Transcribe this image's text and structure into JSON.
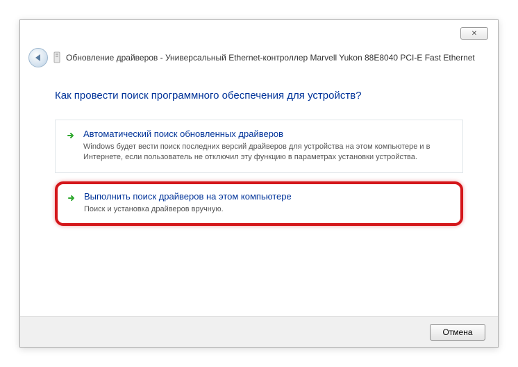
{
  "window": {
    "close_glyph": "✕",
    "title": "Обновление драйверов - Универсальный Ethernet-контроллер Marvell Yukon 88E8040 PCI-E Fast Ethernet"
  },
  "content": {
    "heading": "Как провести поиск программного обеспечения для устройств?",
    "options": [
      {
        "title": "Автоматический поиск обновленных драйверов",
        "desc": "Windows будет вести поиск последних версий драйверов для устройства на этом компьютере и в Интернете, если пользователь не отключил эту функцию в параметрах установки устройства."
      },
      {
        "title": "Выполнить поиск драйверов на этом компьютере",
        "desc": "Поиск и установка драйверов вручную."
      }
    ]
  },
  "footer": {
    "cancel_label": "Отмена"
  }
}
